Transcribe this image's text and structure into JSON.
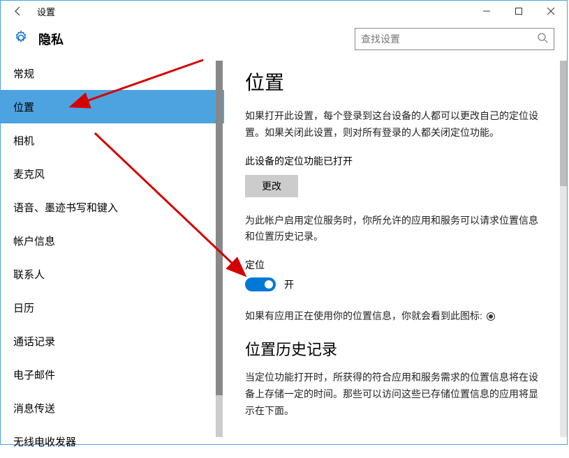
{
  "titlebar": {
    "back": "←",
    "title": "设置"
  },
  "header": {
    "heading": "隐私",
    "search_placeholder": "查找设置"
  },
  "sidebar": {
    "items": [
      {
        "label": "常规"
      },
      {
        "label": "位置"
      },
      {
        "label": "相机"
      },
      {
        "label": "麦克风"
      },
      {
        "label": "语音、墨迹书写和键入"
      },
      {
        "label": "帐户信息"
      },
      {
        "label": "联系人"
      },
      {
        "label": "日历"
      },
      {
        "label": "通话记录"
      },
      {
        "label": "电子邮件"
      },
      {
        "label": "消息传送"
      },
      {
        "label": "无线电收发器"
      }
    ],
    "selected_index": 1
  },
  "content": {
    "heading": "位置",
    "intro": "如果打开此设置，每个登录到这台设备的人都可以更改自己的定位设置。如果关闭此设置，则对所有登录的人都关闭定位功能。",
    "device_status": "此设备的定位功能已打开",
    "change_btn": "更改",
    "account_note": "为此帐户启用定位服务时，你所允许的应用和服务可以请求位置信息和位置历史记录。",
    "location_label": "定位",
    "toggle_state": "开",
    "icon_note": "如果有应用正在使用你的位置信息，你就会看到此图标:",
    "history_heading": "位置历史记录",
    "history_text": "当定位功能打开时，所获得的符合应用和服务需求的位置信息将在设备上存储一定的时间。那些可以访问这些已存储位置信息的应用将显示在下面。"
  }
}
